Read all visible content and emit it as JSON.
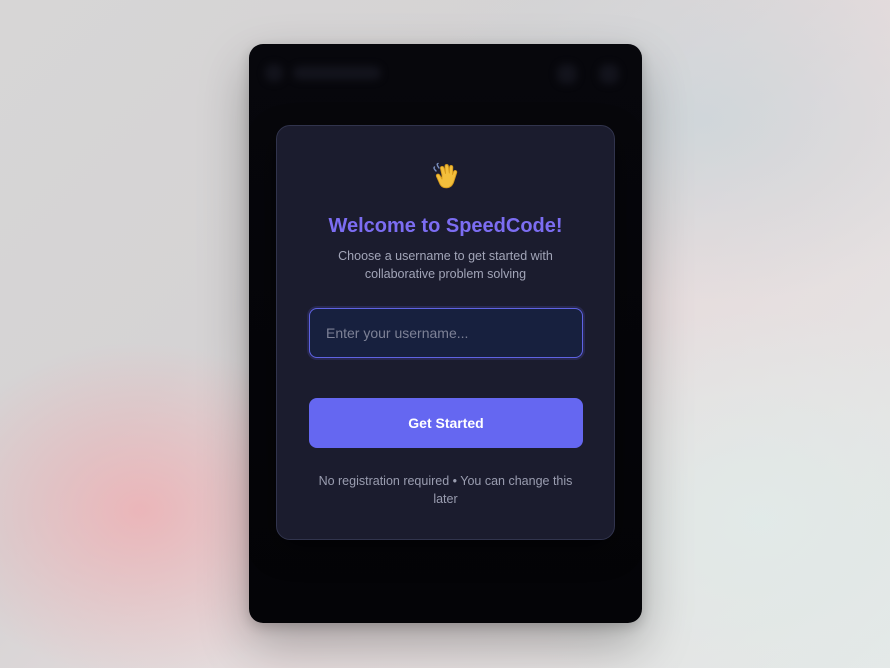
{
  "welcome": {
    "emoji_icon": "waving-hand-icon",
    "title": "Welcome to SpeedCode!",
    "subtitle": "Choose a username to get started with collaborative problem solving",
    "username_placeholder": "Enter your username...",
    "username_value": "",
    "button_label": "Get Started",
    "footer_note": "No registration required • You can change this later"
  },
  "colors": {
    "accent": "#6567f1",
    "title": "#7c6df2",
    "card_background": "#1b1c2e",
    "window_background": "#050508"
  }
}
